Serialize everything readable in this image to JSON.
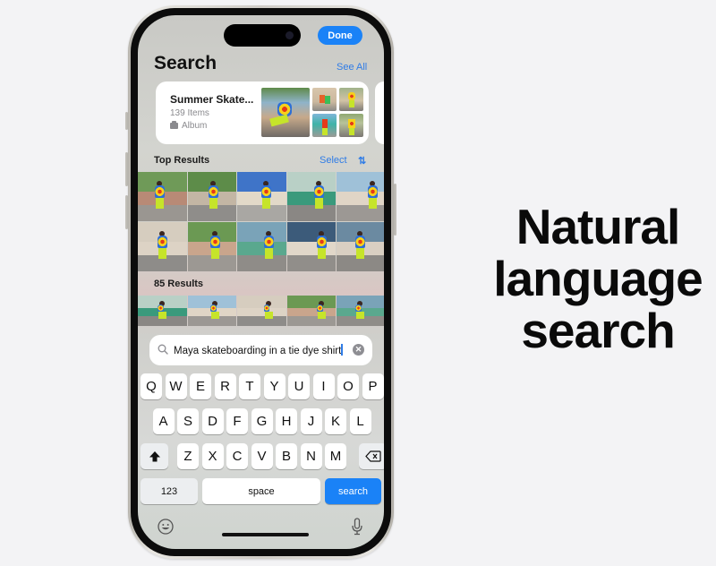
{
  "headline": {
    "lines": [
      "Natural",
      "language",
      "search"
    ]
  },
  "phone": {
    "header": {
      "done_label": "Done",
      "title": "Search",
      "see_all_label": "See All"
    },
    "album": {
      "title": "Summer Skate...",
      "count": "139 Items",
      "type_label": "Album",
      "type_icon": "album-icon"
    },
    "top_results": {
      "label": "Top Results",
      "select_label": "Select",
      "sort_icon": "sort-arrows-icon",
      "photo_count": 10
    },
    "more_results": {
      "label": "85 Results"
    },
    "search": {
      "icon": "magnifying-glass-icon",
      "value": "Maya skateboarding in a tie dye shirt",
      "clear_icon": "clear-x-icon"
    },
    "keyboard": {
      "row1": [
        "Q",
        "W",
        "E",
        "R",
        "T",
        "Y",
        "U",
        "I",
        "O",
        "P"
      ],
      "row2": [
        "A",
        "S",
        "D",
        "F",
        "G",
        "H",
        "J",
        "K",
        "L"
      ],
      "row3": [
        "Z",
        "X",
        "C",
        "V",
        "B",
        "N",
        "M"
      ],
      "shift_icon": "shift-arrow-icon",
      "delete_icon": "backspace-icon",
      "numbers_label": "123",
      "space_label": "space",
      "search_label": "search",
      "emoji_icon": "emoji-icon",
      "mic_icon": "microphone-icon"
    },
    "colors": {
      "accent": "#1a82f7",
      "link": "#2f7ce6",
      "tie_dye_red": "#e53a1a",
      "tie_dye_yellow": "#f6d11b",
      "tie_dye_blue": "#2e6fd6",
      "pants_green": "#c6e42a"
    }
  }
}
